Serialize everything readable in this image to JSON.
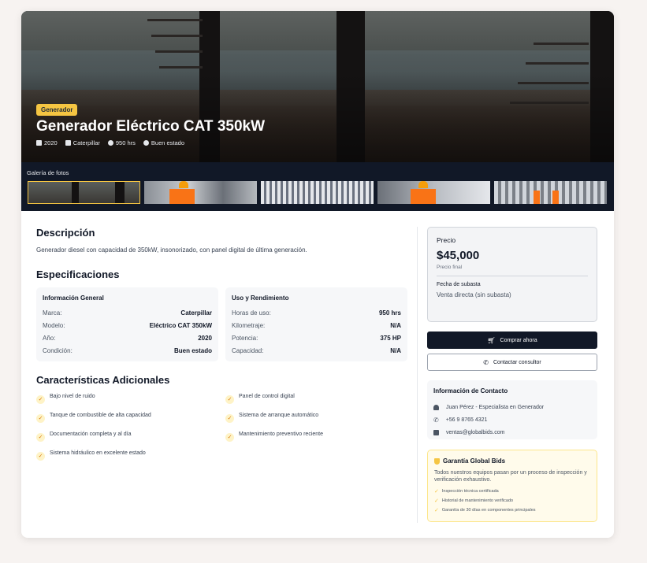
{
  "hero": {
    "category": "Generador",
    "title": "Generador Eléctrico CAT 350kW",
    "meta": [
      {
        "icon": "calendar-icon",
        "text": "2020"
      },
      {
        "icon": "tag-icon",
        "text": "Caterpillar"
      },
      {
        "icon": "gauge-icon",
        "text": "950 hrs"
      },
      {
        "icon": "check-circle-icon",
        "text": "Buen estado"
      }
    ]
  },
  "gallery": {
    "label": "Galería de fotos",
    "active_index": 0
  },
  "description": {
    "heading": "Descripción",
    "text": "Generador diesel con capacidad de 350kW, insonorizado, con panel digital de última generación."
  },
  "specs": {
    "heading": "Especificaciones",
    "general": {
      "title": "Información General",
      "rows": [
        {
          "key": "Marca:",
          "value": "Caterpillar"
        },
        {
          "key": "Modelo:",
          "value": "Eléctrico CAT 350kW"
        },
        {
          "key": "Año:",
          "value": "2020"
        },
        {
          "key": "Condición:",
          "value": "Buen estado"
        }
      ]
    },
    "usage": {
      "title": "Uso y Rendimiento",
      "rows": [
        {
          "key": "Horas de uso:",
          "value": "950 hrs"
        },
        {
          "key": "Kilometraje:",
          "value": "N/A"
        },
        {
          "key": "Potencia:",
          "value": "375 HP"
        },
        {
          "key": "Capacidad:",
          "value": "N/A"
        }
      ]
    }
  },
  "features": {
    "heading": "Características Adicionales",
    "items": [
      "Bajo nivel de ruido",
      "Panel de control digital",
      "Tanque de combustible de alta capacidad",
      "Sistema de arranque automático",
      "Documentación completa y al día",
      "Mantenimiento preventivo reciente",
      "Sistema hidráulico en excelente estado"
    ]
  },
  "price": {
    "label": "Precio",
    "value": "$45,000",
    "sub": "Precio final",
    "auction_label": "Fecha de subasta",
    "auction_value": "Venta directa (sin subasta)"
  },
  "buttons": {
    "buy": "Comprar ahora",
    "contact": "Contactar consultor"
  },
  "contact": {
    "title": "Información de Contacto",
    "name": "Juan Pérez - Especialista en Generador",
    "phone": "+56 9 8765 4321",
    "email": "ventas@globalbids.com"
  },
  "warranty": {
    "title": "Garantía Global Bids",
    "text": "Todos nuestros equipos pasan por un proceso de inspección y verificación exhaustivo.",
    "items": [
      "Inspección técnica certificada",
      "Historial de mantenimiento verificado",
      "Garantía de 30 días en componentes principales"
    ]
  },
  "colors": {
    "accent": "#f5c542",
    "dark": "#111827"
  }
}
